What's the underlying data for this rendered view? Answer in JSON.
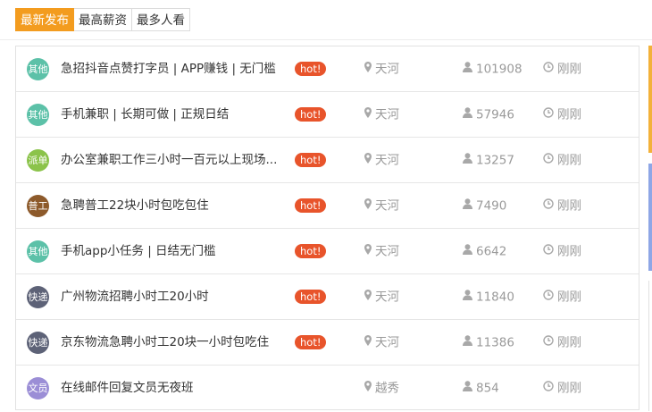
{
  "tabs": [
    "最新发布",
    "最高薪资",
    "最多人看"
  ],
  "active_tab": 0,
  "colors": {
    "active_tab": "#f39c1f",
    "hot_badge": "#e8542b"
  },
  "jobs": [
    {
      "category": "其他",
      "cat_color": "#5cc1a8",
      "title": "急招抖音点赞打字员 | APP赚钱 | 无门槛",
      "hot": "hot!",
      "location": "天河",
      "views": "101908",
      "time": "刚刚"
    },
    {
      "category": "其他",
      "cat_color": "#5cc1a8",
      "title": "手机兼职 | 长期可做 | 正规日结",
      "hot": "hot!",
      "location": "天河",
      "views": "57946",
      "time": "刚刚"
    },
    {
      "category": "派单",
      "cat_color": "#8bc34a",
      "title": "办公室兼职工作三小时一百元以上现场...",
      "hot": "hot!",
      "location": "天河",
      "views": "13257",
      "time": "刚刚"
    },
    {
      "category": "普工",
      "cat_color": "#8d5a2b",
      "title": "急聘普工22块小时包吃包住",
      "hot": "hot!",
      "location": "天河",
      "views": "7490",
      "time": "刚刚"
    },
    {
      "category": "其他",
      "cat_color": "#5cc1a8",
      "title": "手机app小任务 | 日结无门槛",
      "hot": "hot!",
      "location": "天河",
      "views": "6642",
      "time": "刚刚"
    },
    {
      "category": "快递",
      "cat_color": "#5d6277",
      "title": "广州物流招聘小时工20小时",
      "hot": "hot!",
      "location": "天河",
      "views": "11840",
      "time": "刚刚"
    },
    {
      "category": "快递",
      "cat_color": "#5d6277",
      "title": "京东物流急聘小时工20块一小时包吃住",
      "hot": "hot!",
      "location": "天河",
      "views": "11386",
      "time": "刚刚"
    },
    {
      "category": "文员",
      "cat_color": "#9b8ed6",
      "title": "在线邮件回复文员无夜班",
      "hot": "",
      "location": "越秀",
      "views": "854",
      "time": "刚刚"
    }
  ]
}
